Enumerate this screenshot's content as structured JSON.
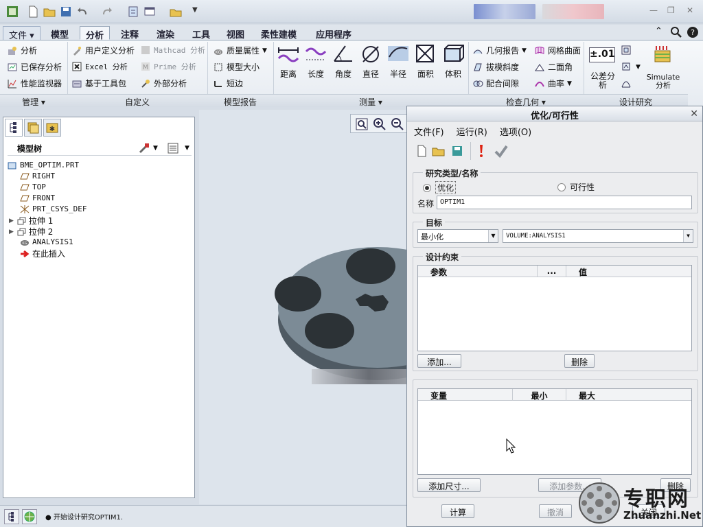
{
  "ribbon_tabs": [
    {
      "label": "文件 ▾",
      "name": "tab-file"
    },
    {
      "label": "模型",
      "name": "tab-model"
    },
    {
      "label": "分析",
      "name": "tab-analysis"
    },
    {
      "label": "注释",
      "name": "tab-annotate"
    },
    {
      "label": "渲染",
      "name": "tab-render"
    },
    {
      "label": "工具",
      "name": "tab-tools"
    },
    {
      "label": "视图",
      "name": "tab-view"
    },
    {
      "label": "柔性建模",
      "name": "tab-flexible-modeling"
    },
    {
      "label": "应用程序",
      "name": "tab-applications"
    }
  ],
  "ribbon": {
    "manage": {
      "analysis": "分析",
      "saved_analysis": "已保存分析",
      "perf_monitor": "性能监视器",
      "group": "管理 ▾"
    },
    "custom": {
      "user_defined": "用户定义分析",
      "mathcad": "Mathcad 分析",
      "excel": "Excel 分析",
      "prime": "Prime 分析",
      "toolkit": "基于工具包",
      "external": "外部分析",
      "group": "自定义"
    },
    "model_report": {
      "mass_props": "质量属性",
      "model_size": "模型大小",
      "short_edge": "短边",
      "group": "模型报告"
    },
    "measure": {
      "distance": "距离",
      "length": "长度",
      "angle": "角度",
      "diameter": "直径",
      "radius": "半径",
      "area": "面积",
      "volume": "体积",
      "group": "测量 ▾"
    },
    "inspect": {
      "geom_report": "几何报告",
      "mesh_surface": "网格曲面",
      "draft": "拔模斜度",
      "dihedral": "二面角",
      "mating_gap": "配合间隙",
      "curvature": "曲率",
      "group": "检查几何 ▾"
    },
    "design_study": {
      "tolerance": "公差分析",
      "tol_icon": "±.01",
      "simulate": "Simulate",
      "simulate_sub": "分析",
      "group": "设计研究"
    }
  },
  "model_tree": {
    "title": "模型树",
    "items": [
      {
        "label": "BME_OPTIM.PRT",
        "icon": "part-icon"
      },
      {
        "label": "RIGHT",
        "icon": "datum-plane-icon"
      },
      {
        "label": "TOP",
        "icon": "datum-plane-icon"
      },
      {
        "label": "FRONT",
        "icon": "datum-plane-icon"
      },
      {
        "label": "PRT_CSYS_DEF",
        "icon": "csys-icon"
      },
      {
        "label": "拉伸 1",
        "icon": "extrude-icon"
      },
      {
        "label": "拉伸 2",
        "icon": "extrude-icon"
      },
      {
        "label": "ANALYSIS1",
        "icon": "analysis-feature-icon"
      },
      {
        "label": "在此插入",
        "icon": "insert-here-icon"
      }
    ]
  },
  "status": {
    "message": "● 开始设计研究OPTIM1."
  },
  "dialog": {
    "title": "优化/可行性",
    "menu": [
      "文件(F)",
      "运行(R)",
      "选项(O)"
    ],
    "study_section": "研究类型/名称",
    "opt_label": "优化",
    "feas_label": "可行性",
    "name_label": "名称",
    "name_value": "OPTIM1",
    "goal_section": "目标",
    "goal_mode": "最小化",
    "goal_param": "VOLUME:ANALYSIS1",
    "constraint_section": "设计约束",
    "constraint_cols": [
      "参数",
      "...",
      "值"
    ],
    "add_btn": "添加...",
    "delete_btn": "删除",
    "var_cols": [
      "变量",
      "最小",
      "最大"
    ],
    "add_dim_btn": "添加尺寸...",
    "add_param_btn": "添加参数...",
    "delete_btn2": "删除",
    "compute_btn": "计算",
    "cancel_btn": "撤消",
    "close_btn": "关闭"
  },
  "watermark": {
    "brand": "专职网",
    "url": "Zhuanzhi.Net"
  }
}
